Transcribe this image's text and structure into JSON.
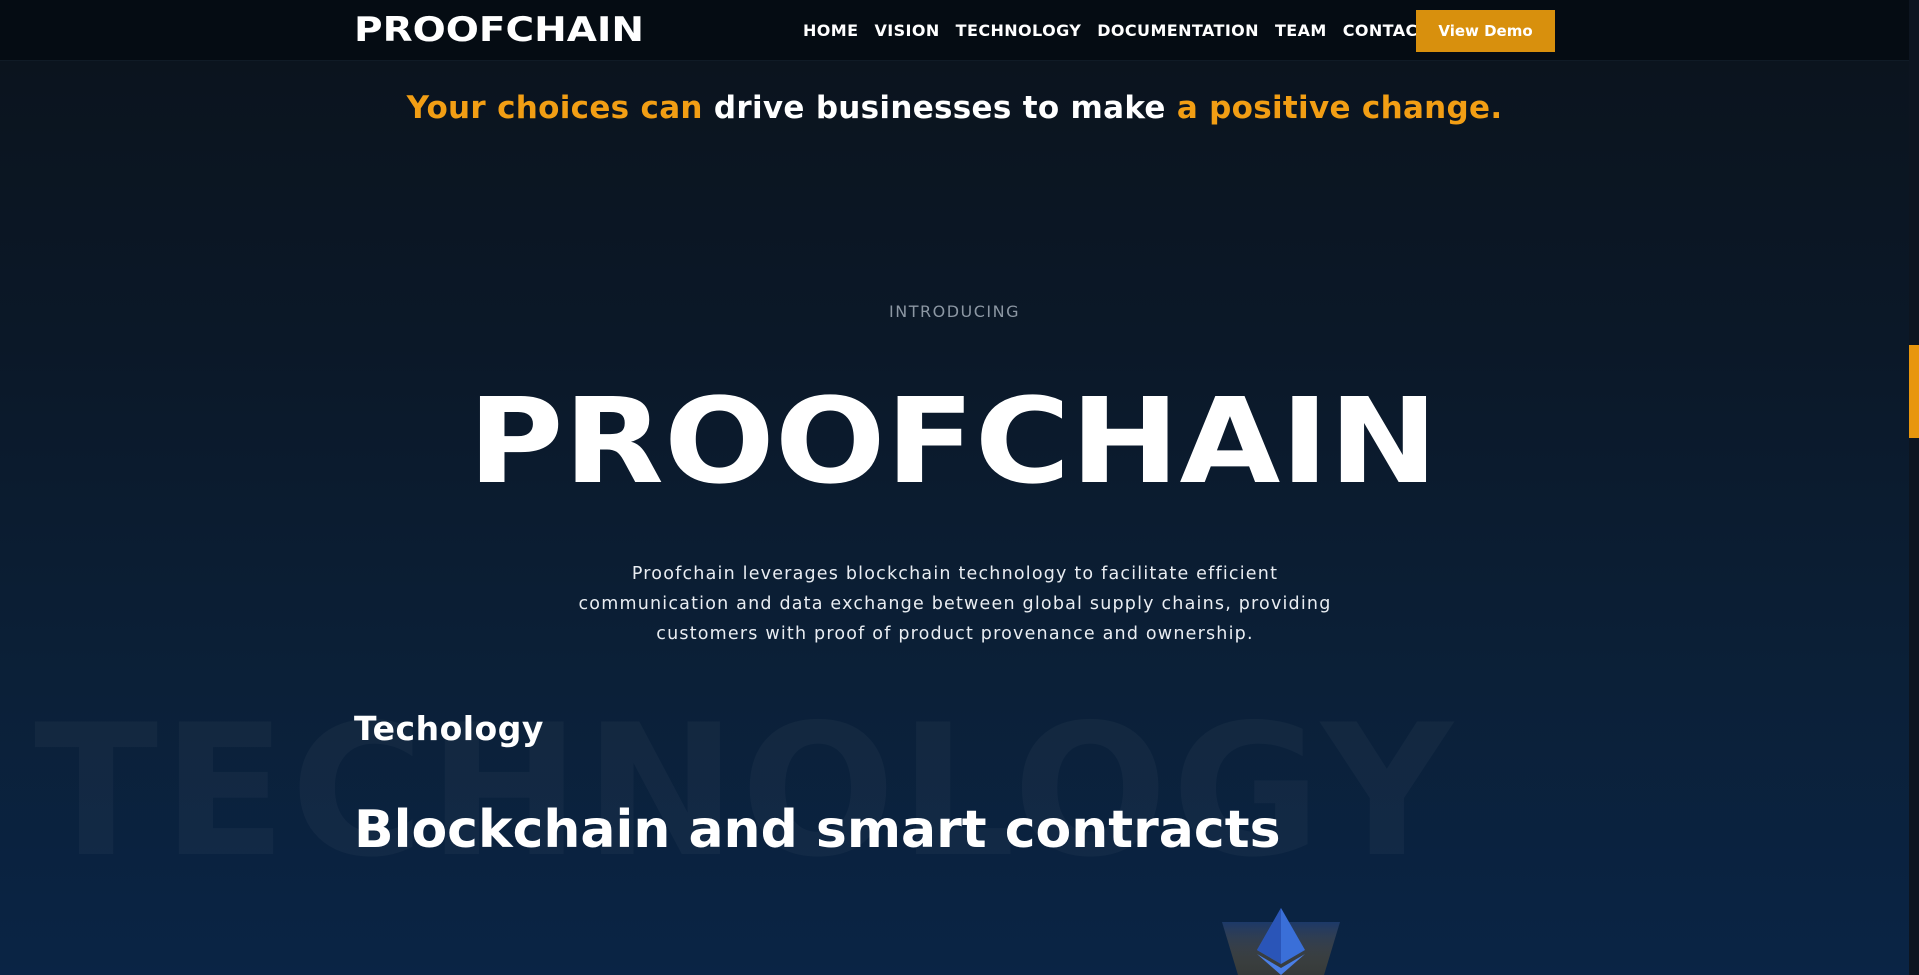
{
  "header": {
    "logo_text": "PROOFCHAIN",
    "nav": [
      {
        "label": "HOME"
      },
      {
        "label": "VISION"
      },
      {
        "label": "TECHNOLOGY"
      },
      {
        "label": "DOCUMENTATION"
      },
      {
        "label": "TEAM"
      },
      {
        "label": "CONTACT"
      }
    ],
    "cta_label": "View Demo"
  },
  "tagline": {
    "part1": "Your choices can",
    "part2": "drive businesses to make",
    "part3": "a positive change."
  },
  "hero": {
    "intro": "INTRODUCING",
    "logo_text": "PROOFCHAIN",
    "description": "Proofchain leverages blockchain technology to facilitate efficient communication and data exchange between global supply chains, providing customers with proof of product provenance and ownership."
  },
  "technology": {
    "watermark": "TECHNOLOGY",
    "label": "Techology",
    "heading": "Blockchain and smart contracts"
  },
  "colors": {
    "accent": "#f29e14",
    "button": "#d8900d",
    "background_top": "#0b131c",
    "background_bottom": "#0a2445"
  },
  "icons": {
    "hero_graphic": "ethereum-diamond-icon"
  }
}
